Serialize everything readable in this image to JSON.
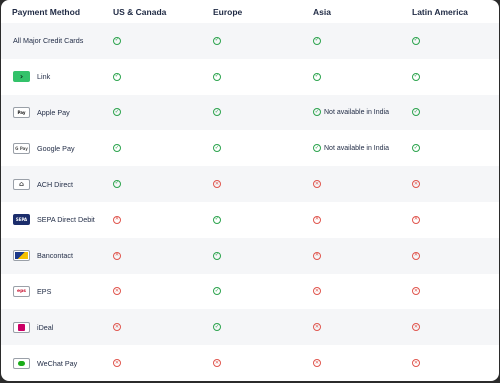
{
  "headers": [
    "Payment Method",
    "US & Canada",
    "Europe",
    "Asia",
    "Latin America"
  ],
  "rows": [
    {
      "method": "All Major Credit Cards",
      "badge": "",
      "badge_text": "",
      "cells": [
        {
          "status": "ok",
          "note": ""
        },
        {
          "status": "ok",
          "note": ""
        },
        {
          "status": "ok",
          "note": ""
        },
        {
          "status": "ok",
          "note": ""
        }
      ]
    },
    {
      "method": "Link",
      "badge": "link",
      "badge_text": "›",
      "cells": [
        {
          "status": "ok",
          "note": ""
        },
        {
          "status": "ok",
          "note": ""
        },
        {
          "status": "ok",
          "note": ""
        },
        {
          "status": "ok",
          "note": ""
        }
      ]
    },
    {
      "method": "Apple Pay",
      "badge": "apple",
      "badge_text": "Pay",
      "cells": [
        {
          "status": "ok",
          "note": ""
        },
        {
          "status": "ok",
          "note": ""
        },
        {
          "status": "ok",
          "note": "Not available in India"
        },
        {
          "status": "ok",
          "note": ""
        }
      ]
    },
    {
      "method": "Google Pay",
      "badge": "google",
      "badge_text": "G Pay",
      "cells": [
        {
          "status": "ok",
          "note": ""
        },
        {
          "status": "ok",
          "note": ""
        },
        {
          "status": "ok",
          "note": "Not available in India"
        },
        {
          "status": "ok",
          "note": ""
        }
      ]
    },
    {
      "method": "ACH Direct",
      "badge": "ach",
      "badge_text": "⌂",
      "cells": [
        {
          "status": "ok",
          "note": ""
        },
        {
          "status": "no",
          "note": ""
        },
        {
          "status": "no",
          "note": ""
        },
        {
          "status": "no",
          "note": ""
        }
      ]
    },
    {
      "method": "SEPA Direct Debit",
      "badge": "sepa",
      "badge_text": "SEPA",
      "cells": [
        {
          "status": "no",
          "note": ""
        },
        {
          "status": "ok",
          "note": ""
        },
        {
          "status": "no",
          "note": ""
        },
        {
          "status": "no",
          "note": ""
        }
      ]
    },
    {
      "method": "Bancontact",
      "badge": "banc",
      "badge_text": "",
      "cells": [
        {
          "status": "no",
          "note": ""
        },
        {
          "status": "ok",
          "note": ""
        },
        {
          "status": "no",
          "note": ""
        },
        {
          "status": "no",
          "note": ""
        }
      ]
    },
    {
      "method": "EPS",
      "badge": "eps",
      "badge_text": "eps",
      "cells": [
        {
          "status": "no",
          "note": ""
        },
        {
          "status": "ok",
          "note": ""
        },
        {
          "status": "no",
          "note": ""
        },
        {
          "status": "no",
          "note": ""
        }
      ]
    },
    {
      "method": "iDeal",
      "badge": "ideal",
      "badge_text": "",
      "cells": [
        {
          "status": "no",
          "note": ""
        },
        {
          "status": "ok",
          "note": ""
        },
        {
          "status": "no",
          "note": ""
        },
        {
          "status": "no",
          "note": ""
        }
      ]
    },
    {
      "method": "WeChat Pay",
      "badge": "wechat",
      "badge_text": "",
      "cells": [
        {
          "status": "no",
          "note": ""
        },
        {
          "status": "no",
          "note": ""
        },
        {
          "status": "no",
          "note": ""
        },
        {
          "status": "no",
          "note": ""
        }
      ]
    }
  ],
  "icons": {
    "ok": "check-circle-icon",
    "no": "x-circle-icon"
  },
  "colors": {
    "ok": "#2da44e",
    "no": "#e0564e",
    "stripe": "#f5f6f8",
    "text": "#1f2a44"
  }
}
